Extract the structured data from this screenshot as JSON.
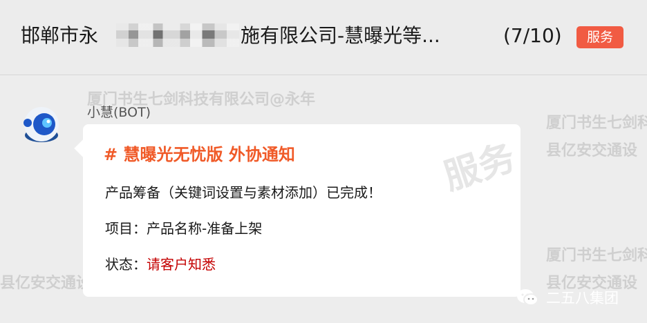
{
  "header": {
    "title_prefix": "邯郸市永",
    "title_suffix": "施有限公司-慧曝光等...",
    "counter": "(7/10)",
    "badge": "服务"
  },
  "chat": {
    "sender": "小慧(BOT)",
    "message": {
      "title": "# 慧曝光无忧版 外协通知",
      "line1": "产品筹备（关键词设置与素材添加）已完成！",
      "item_label": "项目：",
      "item_value": "产品名称-准备上架",
      "status_label": "状态：",
      "status_value": "请客户知悉"
    }
  },
  "watermarks": {
    "w1": "厦门书生七剑科技有限公司@永年",
    "w2": "厦门书生七剑科",
    "w3": "县亿安交通设",
    "w4": "厦门书生七剑科",
    "w5": "县亿安交通设",
    "w6": "县亿安交通设",
    "stamp": "服务"
  },
  "footer": {
    "brand": "二五八集团",
    "icon": "wechat-icon"
  }
}
